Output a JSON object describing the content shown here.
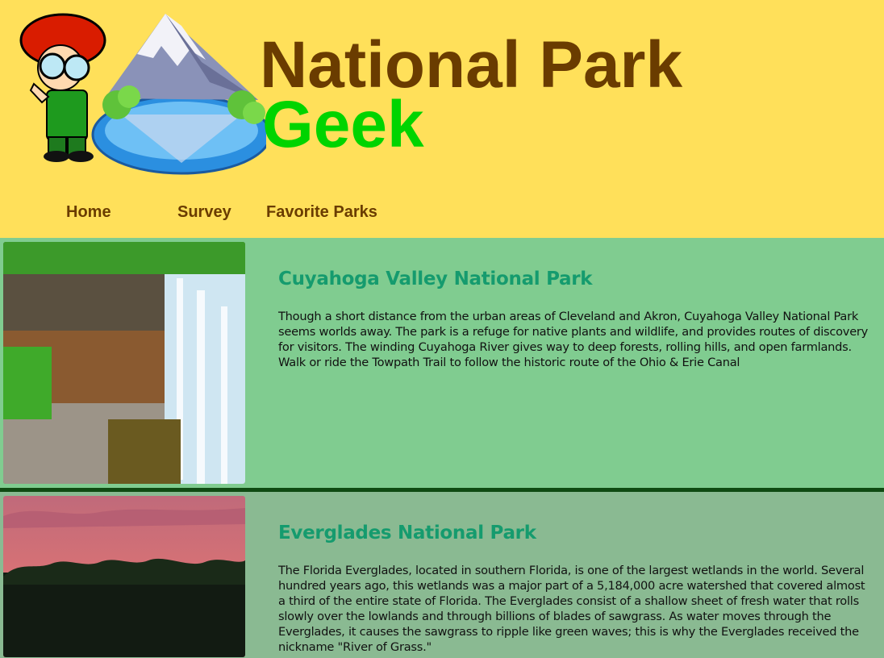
{
  "header": {
    "title_line1": "National Park",
    "title_line2": "Geek",
    "logo_icon": "mascot-mountain-logo"
  },
  "nav": {
    "items": [
      {
        "label": "Home"
      },
      {
        "label": "Survey"
      },
      {
        "label": "Favorite Parks"
      }
    ]
  },
  "parks": [
    {
      "name": "Cuyahoga Valley National Park",
      "image": "waterfall-photo",
      "description": "Though a short distance from the urban areas of Cleveland and Akron, Cuyahoga Valley National Park seems worlds away. The park is a refuge for native plants and wildlife, and provides routes of discovery for visitors. The winding Cuyahoga River gives way to deep forests, rolling hills, and open farmlands. Walk or ride the Towpath Trail to follow the historic route of the Ohio & Erie Canal"
    },
    {
      "name": "Everglades National Park",
      "image": "sunset-forest-photo",
      "description": "The Florida Everglades, located in southern Florida, is one of the largest wetlands in the world. Several hundred years ago, this wetlands was a major part of a 5,184,000 acre watershed that covered almost a third of the entire state of Florida. The Everglades consist of a shallow sheet of fresh water that rolls slowly over the lowlands and through billions of blades of sawgrass. As water moves through the Everglades, it causes the sawgrass to ripple like green waves; this is why the Everglades received the nickname \"River of Grass.\""
    }
  ],
  "colors": {
    "header_bg": "#ffe05a",
    "title_brown": "#6a3c00",
    "title_green": "#00d400",
    "park_title": "#159b6e",
    "park1_bg": "#80cc90",
    "park2_bg": "#8aba92"
  }
}
